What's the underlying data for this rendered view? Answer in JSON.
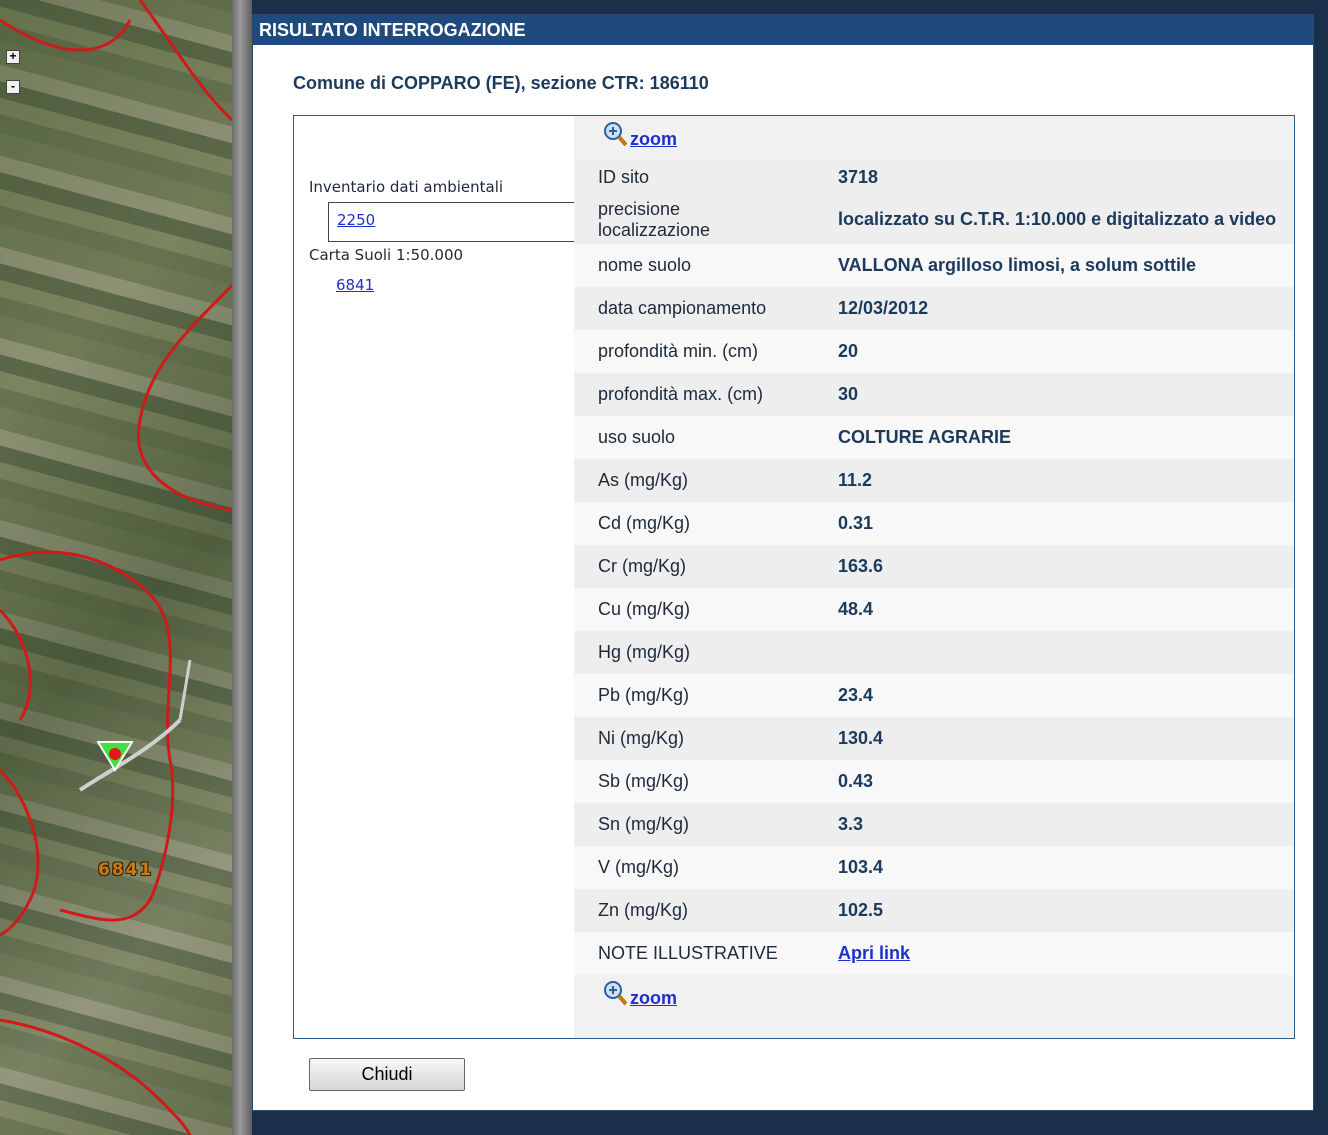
{
  "map": {
    "zoom_in": "+",
    "zoom_out": "-",
    "polygon_label": "6841",
    "marker_icon": "site-marker-icon",
    "boundary_color": "#d01a1a"
  },
  "dialog": {
    "title": "RISULTATO INTERROGAZIONE",
    "subtitle": "Comune di COPPARO (FE), sezione CTR: 186110",
    "left": {
      "inventario_label": "Inventario dati ambientali",
      "inventario_link": "2250",
      "carta_label": "Carta Suoli 1:50.000",
      "carta_link": "6841"
    },
    "zoom_label": "zoom",
    "rows": [
      {
        "label": "ID sito",
        "value": "3718"
      },
      {
        "label": "precisione localizzazione",
        "value": "localizzato su C.T.R. 1:10.000 e digitalizzato a video"
      },
      {
        "label": "nome suolo",
        "value": "VALLONA argilloso limosi, a solum sottile"
      },
      {
        "label": "data campionamento",
        "value": "12/03/2012"
      },
      {
        "label": "profondità min. (cm)",
        "value": "20"
      },
      {
        "label": "profondità max. (cm)",
        "value": "30"
      },
      {
        "label": "uso suolo",
        "value": "COLTURE AGRARIE"
      },
      {
        "label": "As (mg/Kg)",
        "value": "11.2"
      },
      {
        "label": "Cd (mg/Kg)",
        "value": "0.31"
      },
      {
        "label": "Cr (mg/Kg)",
        "value": "163.6"
      },
      {
        "label": "Cu (mg/Kg)",
        "value": "48.4"
      },
      {
        "label": "Hg (mg/Kg)",
        "value": ""
      },
      {
        "label": "Pb (mg/Kg)",
        "value": "23.4"
      },
      {
        "label": "Ni (mg/Kg)",
        "value": "130.4"
      },
      {
        "label": "Sb (mg/Kg)",
        "value": "0.43"
      },
      {
        "label": "Sn (mg/Kg)",
        "value": "3.3"
      },
      {
        "label": "V (mg/Kg)",
        "value": "103.4"
      },
      {
        "label": "Zn (mg/Kg)",
        "value": "102.5"
      },
      {
        "label": "NOTE ILLUSTRATIVE",
        "value": "Apri link"
      }
    ],
    "close_button": "Chiudi"
  }
}
